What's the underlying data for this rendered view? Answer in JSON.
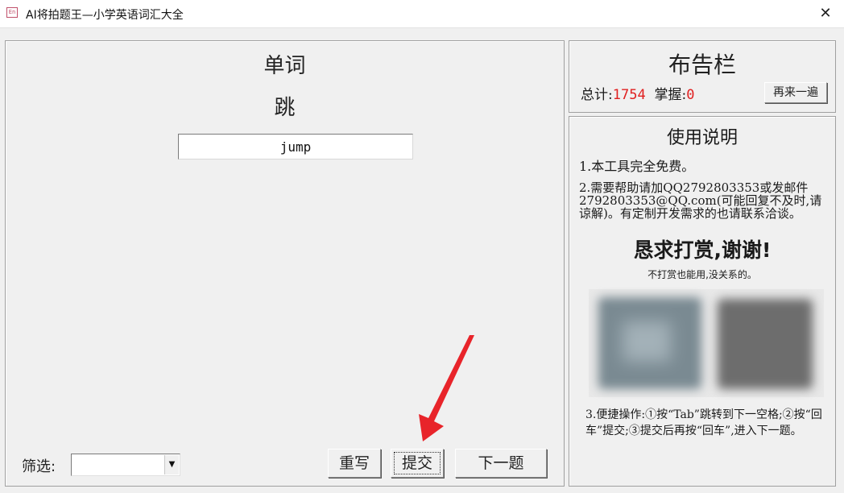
{
  "window": {
    "icon_text": "En",
    "title": "AI将拍题王—小学英语词汇大全",
    "close_symbol": "✕"
  },
  "quiz": {
    "heading": "单词",
    "meaning": "跳",
    "answer_value": "jump",
    "filter_label": "筛选:",
    "filter_value": "",
    "dropdown_symbol": "▼",
    "rewrite_label": "重写",
    "submit_label": "提交",
    "next_label": "下一题"
  },
  "board": {
    "title": "布告栏",
    "total_label": "总计:",
    "total_value": "1754",
    "mastered_label": "掌握:",
    "mastered_value": "0",
    "again_label": "再来一遍"
  },
  "help": {
    "title": "使用说明",
    "line1": "1.本工具完全免费。",
    "line2": "2.需要帮助请加QQ2792803353或发邮件2792803353@QQ.com(可能回复不及时,请谅解)。有定制开发需求的也请联系洽谈。",
    "donate_title": "恳求打赏,谢谢!",
    "donate_sub": "不打赏也能用,没关系的。",
    "line3": "3.便捷操作:①按“Tab”跳转到下一空格;②按“回车”提交;③提交后再按“回车”,进入下一题。"
  },
  "colors": {
    "accent_red": "#e02020",
    "arrow_red": "#e8242a"
  }
}
